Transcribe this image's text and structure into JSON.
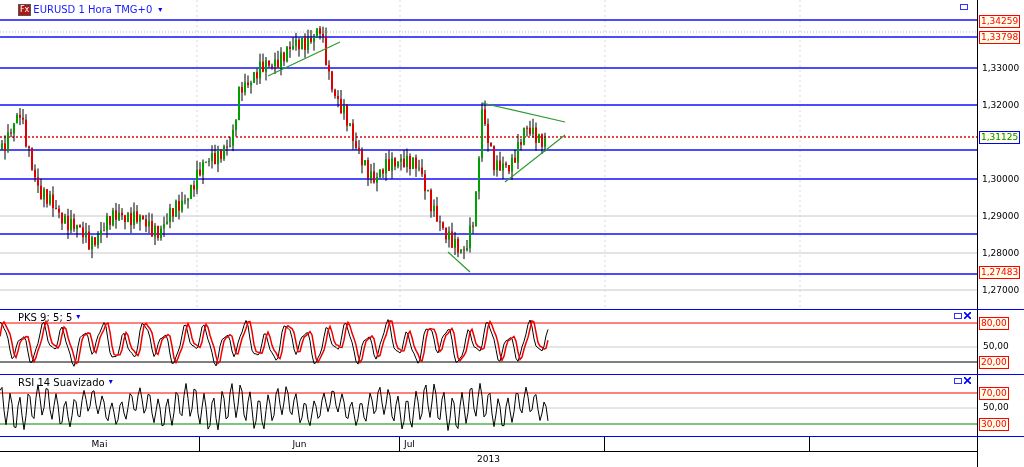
{
  "header": {
    "badge": "Fx",
    "title": "EURUSD 1 Hora TMG+0",
    "menu_caret": "▾"
  },
  "price_axis": {
    "ticks": [
      "1,33000",
      "1,32000",
      "1,30000",
      "1,29000",
      "1,28000",
      "1,27000"
    ],
    "labels": [
      {
        "text": "1,34259",
        "kind": "line"
      },
      {
        "text": "1,33798",
        "kind": "line"
      },
      {
        "text": "1,31125",
        "kind": "current"
      },
      {
        "text": "1,27483",
        "kind": "line"
      }
    ]
  },
  "indicators": [
    {
      "title": "PKS 9; 5; 5",
      "menu_caret": "▾",
      "kind": "stochastic",
      "levels": [
        {
          "text": "80,00",
          "kind": "bound"
        },
        {
          "text": "50,00",
          "kind": "tick"
        },
        {
          "text": "20,00",
          "kind": "bound"
        }
      ]
    },
    {
      "title": "RSI 14 Suavizado",
      "menu_caret": "▾",
      "kind": "rsi",
      "levels": [
        {
          "text": "70,00",
          "kind": "bound"
        },
        {
          "text": "50,00",
          "kind": "tick"
        },
        {
          "text": "30,00",
          "kind": "bound"
        }
      ]
    }
  ],
  "time_axis": {
    "months": [
      "Mai",
      "Jun",
      "Jul"
    ],
    "year": "2013"
  }
}
